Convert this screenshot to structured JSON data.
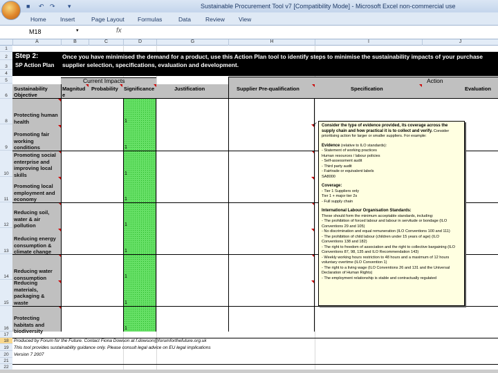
{
  "window": {
    "title": "Sustainable Procurement Tool v7 [Compatibility Mode] - Microsoft Excel non-commercial use"
  },
  "ribbon": {
    "tabs": [
      "Home",
      "Insert",
      "Page Layout",
      "Formulas",
      "Data",
      "Review",
      "View"
    ]
  },
  "formula_bar": {
    "name_box": "M18",
    "fx": "fx",
    "value": ""
  },
  "columns": [
    "A",
    "B",
    "C",
    "D",
    "G",
    "H",
    "I",
    "J"
  ],
  "rows": [
    "1",
    "2",
    "3",
    "4",
    "5",
    "6",
    "8",
    "9",
    "10",
    "11",
    "12",
    "13",
    "14",
    "15",
    "16",
    "17",
    "18",
    "19",
    "20",
    "21",
    "22"
  ],
  "banner": {
    "step": "Step 2:",
    "subtitle": "SP Action Plan",
    "line1": "Once you have minimised the demand for a product, use this Action Plan tool to identify steps to minimise the sustainability impacts of your purchase",
    "line2": "supplier selection, specifications, evaluation and development."
  },
  "headers": {
    "current_impacts": "Current Impacts",
    "action": "Action",
    "objective": "Sustainability Objective",
    "magnitude": "Magnitude",
    "probability": "Probability",
    "significance": "Significance",
    "justification": "Justification",
    "prequal": "Supplier Pre-qualification",
    "specification": "Specification",
    "evaluation": "Evaluation"
  },
  "objectives": [
    {
      "label": "Protecting human health",
      "significance": "1"
    },
    {
      "label": "Promoting fair working conditions",
      "significance": "1"
    },
    {
      "label": "Promoting social enterprise and improving local skills",
      "significance": "1"
    },
    {
      "label": "Promoting local employment and economy",
      "significance": "1"
    },
    {
      "label": "Reducing soil, water & air pollution",
      "significance": "1"
    },
    {
      "label": "Reducing energy consumption & climate change",
      "significance": "1"
    },
    {
      "label": "Reducing water consumption",
      "significance": "1"
    },
    {
      "label": "Reducing materials, packaging & waste",
      "significance": "1"
    },
    {
      "label": "Protecting habitats and biodiversity",
      "significance": "1"
    }
  ],
  "comment": {
    "intro_bold": "Consider the type of evidence provided, its coverage across the supply chain and how practical it is to collect and verify.",
    "intro": "Consider prioritising action for larger or smaller suppliers. For example:",
    "evidence_title": "Evidence",
    "evidence_note": "(relative to ILO standards):",
    "evidence": [
      "- Statement of working practices",
      "  Human resources / labour policies",
      "- Self-assessment audit",
      "- Third party audit",
      "- Fairtrade or equivalent labels",
      "  SA8000"
    ],
    "coverage_title": "Coverage:",
    "coverage": [
      "- Tier 1 Suppliers only",
      "  Tier 1 + major tier 2s",
      "- Full supply chain"
    ],
    "ilo_title": "International Labour Organisation Standards:",
    "ilo_intro": "These should form the minimum acceptable standards, including:",
    "ilo": [
      "- The prohibition of forced labour and labour in servitude or bondage (ILO Conventions 29 and 105)",
      "- No discrimination and equal remuneration (ILO Conventions 100 and 111)",
      "- The prohibition of child labour (children under 15 years of age) (ILO Conventions 138 and 182)",
      "- The right to freedom of association and the right to collective bargaining (ILO Conventions 87, 98, 135 and ILO Recommendation 143)",
      "- Weekly working hours restriction to 48 hours and a maximum of 12 hours voluntary overtime (ILO Convention 1)",
      "- The right to a living wage (ILO Conventions 26 and 131 and the Universal Declaration of Human Rights)",
      "- The employment relationship is stable and contractually regulated"
    ]
  },
  "footer": {
    "line1": "Produced by Forum for the Future. Contact Fiona Dowson at f.dowson@forumforthefuture.org.uk",
    "line2": "This tool provides sustainability guidance only. Please consult legal advice on EU legal implications",
    "line3": "Version 7 2007"
  }
}
